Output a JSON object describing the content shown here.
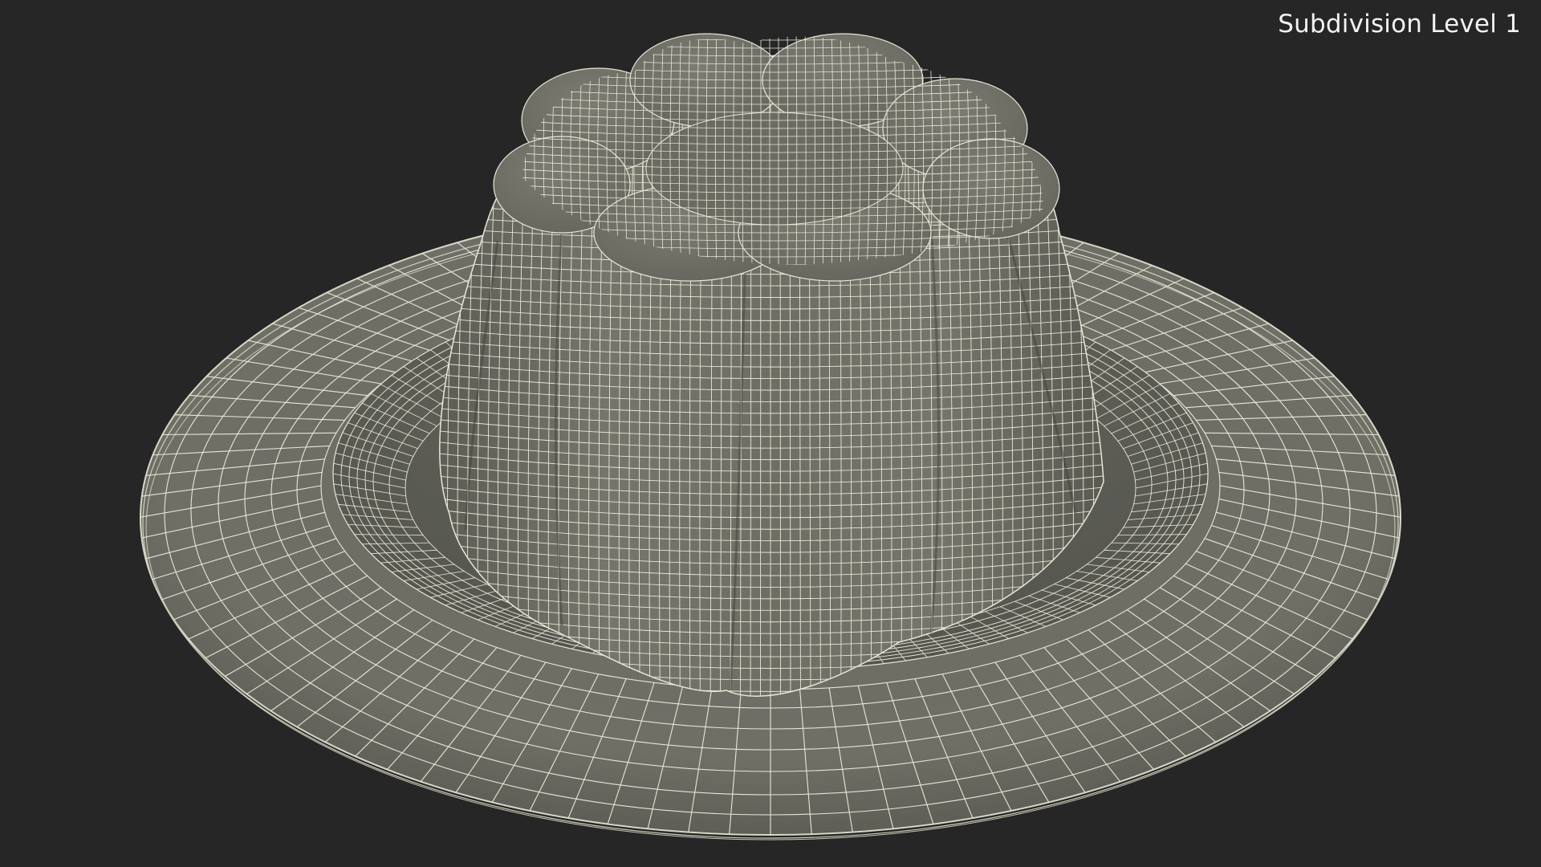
{
  "viewport": {
    "label": "Subdivision Level 1"
  },
  "colors": {
    "background": "#262626",
    "surface": "#6f6f66",
    "surface_dark": "#55554e",
    "wire": "#e8e6d6",
    "label_text": "#f2f2f2"
  },
  "model": {
    "subject": "pudding-mold-dessert-on-plate",
    "shading": "wireframe-over-grey"
  }
}
